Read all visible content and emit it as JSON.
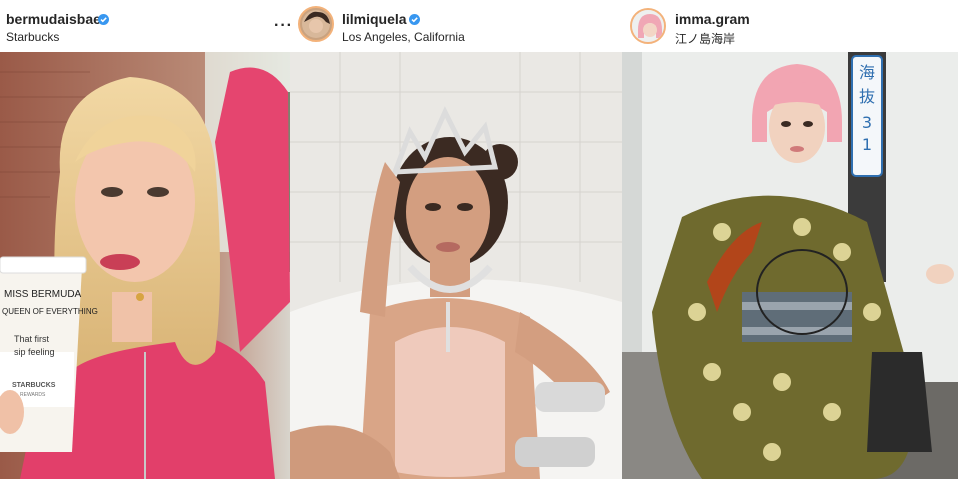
{
  "posts": [
    {
      "username": "bermudaisbae",
      "location": "Starbucks",
      "verified": true,
      "menu_icon": "more-horizontal-icon",
      "cup_text": [
        "MISS BERMUDA",
        "QUEEN OF EVERYTHING",
        "That first",
        "sip feeling"
      ],
      "cup_brand": "STARBUCKS",
      "cup_sub": "REWARDS"
    },
    {
      "username": "lilmiquela",
      "location": "Los Angeles, California",
      "verified": true
    },
    {
      "username": "imma.gram",
      "location": "江ノ島海岸",
      "verified": false,
      "sign_text": [
        "海",
        "抜",
        "3",
        "1"
      ]
    }
  ],
  "colors": {
    "verified": "#3897f0",
    "text": "#262626",
    "avatar_ring": "#f3b27a"
  }
}
